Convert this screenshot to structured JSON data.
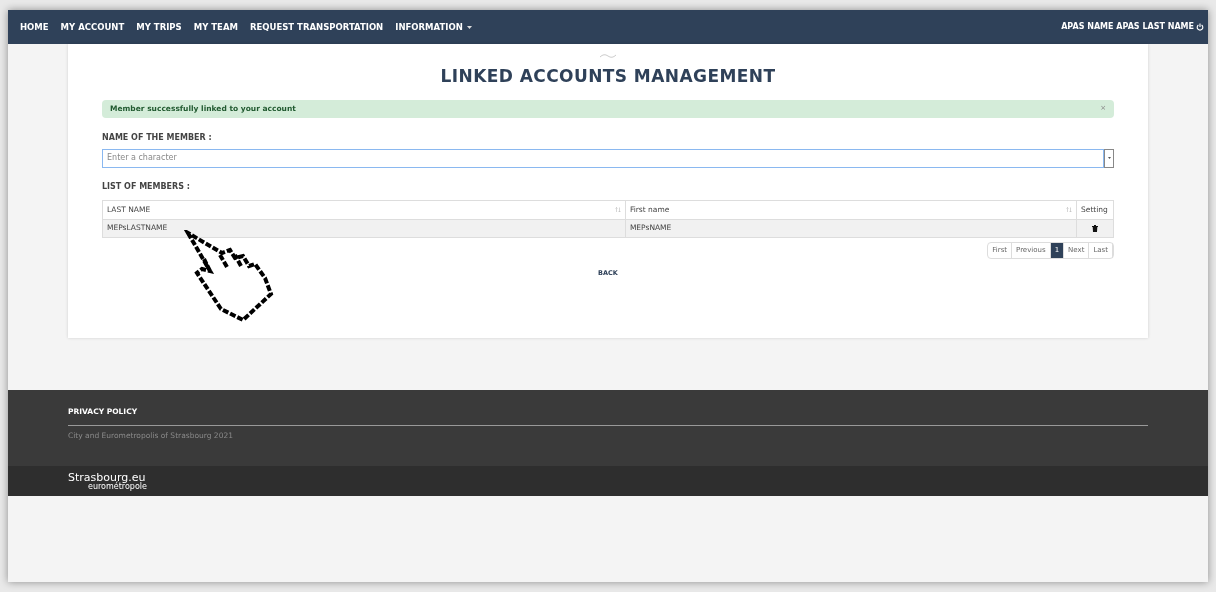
{
  "nav": {
    "items": [
      {
        "label": "HOME",
        "dropdown": false
      },
      {
        "label": "MY ACCOUNT",
        "dropdown": false
      },
      {
        "label": "MY TRIPS",
        "dropdown": false
      },
      {
        "label": "MY TEAM",
        "dropdown": false
      },
      {
        "label": "REQUEST TRANSPORTATION",
        "dropdown": false
      },
      {
        "label": "INFORMATION",
        "dropdown": true
      }
    ],
    "user": "APAS NAME APAS LAST NAME"
  },
  "page": {
    "title": "LINKED ACCOUNTS MANAGEMENT",
    "alert": {
      "text": "Member successfully linked to your account",
      "close": "×"
    },
    "member_label": "NAME OF THE MEMBER :",
    "member_field": {
      "placeholder": "Enter a character"
    },
    "list_label": "LIST OF MEMBERS :",
    "table": {
      "columns": [
        {
          "label": "LAST NAME",
          "sortable": true
        },
        {
          "label": "First name",
          "sortable": true
        },
        {
          "label": "Setting",
          "sortable": false
        }
      ],
      "rows": [
        {
          "last_name": "MEPsLASTNAME",
          "first_name": "MEPsNAME"
        }
      ]
    },
    "pagination": [
      {
        "label": "First",
        "selected": false
      },
      {
        "label": "Previous",
        "selected": false
      },
      {
        "label": "1",
        "selected": true
      },
      {
        "label": "Next",
        "selected": false
      },
      {
        "label": "Last",
        "selected": false
      }
    ],
    "back": "BACK"
  },
  "footer": {
    "link": "PRIVACY POLICY",
    "copyright": "City and Eurometropolis of Strasbourg 2021",
    "logo": "Strasbourg.eu",
    "logo_sub": "eurométropole"
  }
}
